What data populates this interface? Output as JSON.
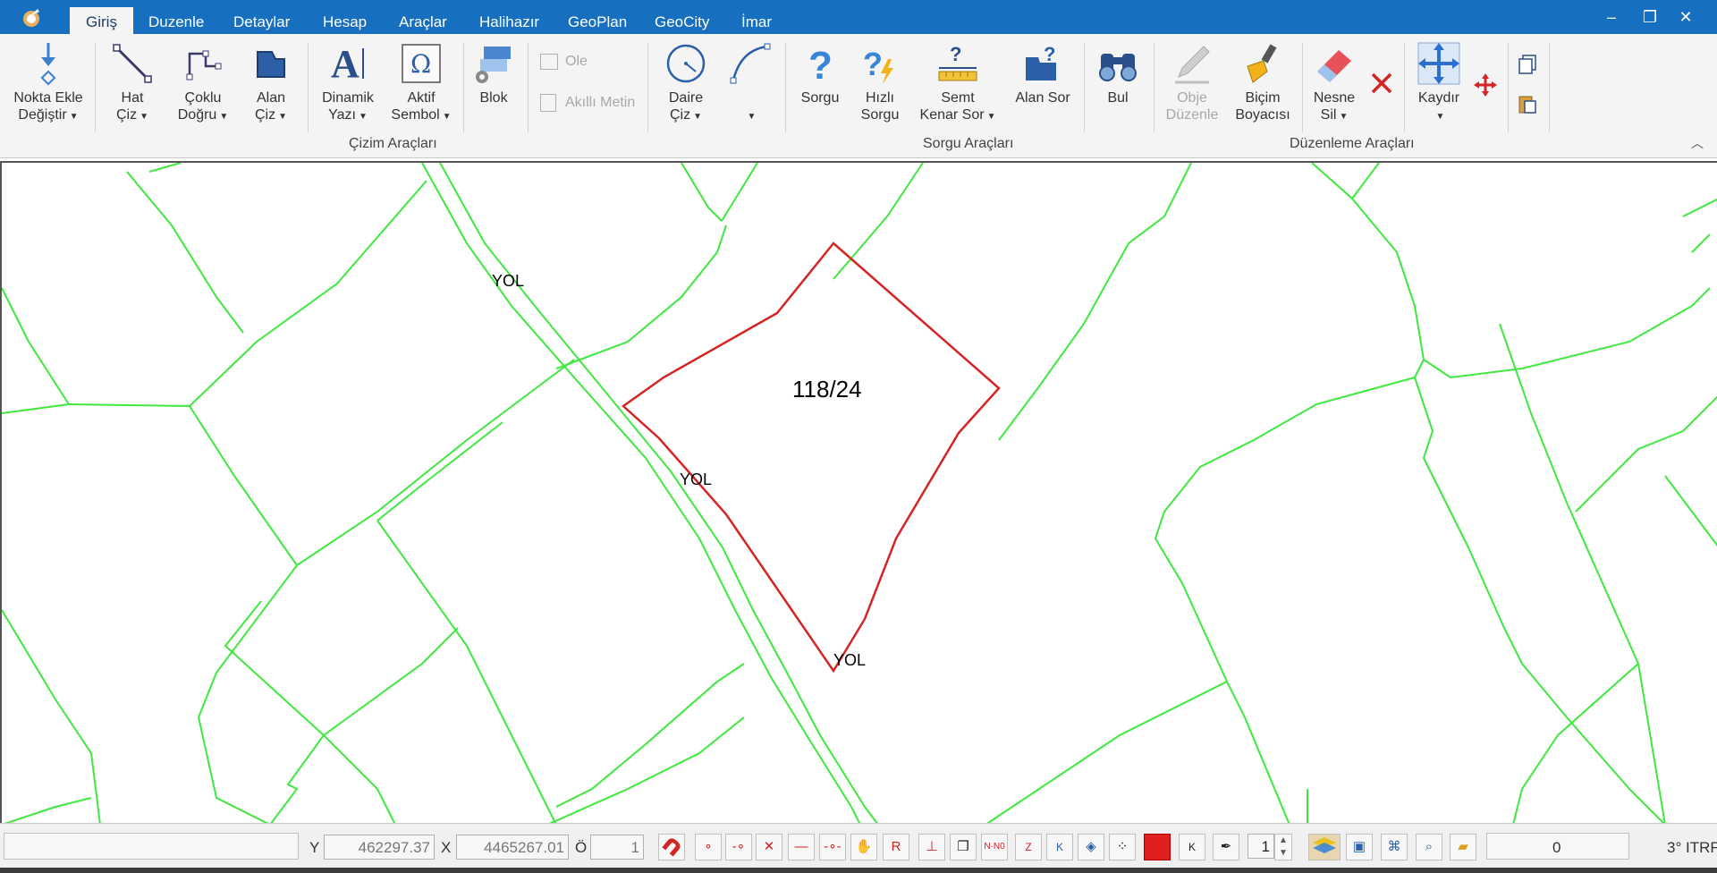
{
  "tabs": [
    {
      "label": "Giriş",
      "active": true
    },
    {
      "label": "Duzenle"
    },
    {
      "label": "Detaylar"
    },
    {
      "label": "Hesap"
    },
    {
      "label": "Araçlar"
    },
    {
      "label": "Halihazır"
    },
    {
      "label": "GeoPlan"
    },
    {
      "label": "GeoCity"
    },
    {
      "label": "İmar"
    }
  ],
  "window_controls": {
    "minimize": "–",
    "restore": "❐",
    "close": "✕"
  },
  "ribbon": {
    "buttons": {
      "nokta_ekle": {
        "l1": "Nokta Ekle",
        "l2": "Değiştir"
      },
      "hat_ciz": {
        "l1": "Hat",
        "l2": "Çiz"
      },
      "coklu_dogru": {
        "l1": "Çoklu",
        "l2": "Doğru"
      },
      "alan_ciz": {
        "l1": "Alan",
        "l2": "Çiz"
      },
      "dinamik_yazi": {
        "l1": "Dinamik",
        "l2": "Yazı"
      },
      "aktif_sembol": {
        "l1": "Aktif",
        "l2": "Sembol"
      },
      "blok": {
        "l1": "Blok"
      },
      "ole": {
        "l1": "Ole"
      },
      "akilli_metin": {
        "l1": "Akıllı Metin"
      },
      "daire_ciz": {
        "l1": "Daire",
        "l2": "Çiz"
      },
      "sorgu": {
        "l1": "Sorgu"
      },
      "hizli_sorgu": {
        "l1": "Hızlı",
        "l2": "Sorgu"
      },
      "semt_kenar": {
        "l1": "Semt",
        "l2": "Kenar Sor"
      },
      "alan_sor": {
        "l1": "Alan Sor"
      },
      "bul": {
        "l1": "Bul"
      },
      "obje_duzenle": {
        "l1": "Obje",
        "l2": "Düzenle"
      },
      "bicim_boyacisi": {
        "l1": "Biçim",
        "l2": "Boyacısı"
      },
      "nesne_sil": {
        "l1": "Nesne",
        "l2": "Sil"
      },
      "kaydir": {
        "l1": "Kaydır"
      }
    },
    "groups": {
      "cizim": "Çizim Araçları",
      "sorgu": "Sorgu Araçları",
      "duzenleme": "Düzenleme Araçları"
    }
  },
  "map": {
    "road_labels": [
      "YOL",
      "YOL",
      "YOL"
    ],
    "parcel_label": "118/24",
    "parcel_line_color": "#d42424",
    "boundary_color": "#3fe83f"
  },
  "statusbar": {
    "y_label": "Y",
    "y_value": "462297.37",
    "x_label": "X",
    "x_value": "4465267.01",
    "o_label": "Ö",
    "o_value": "1",
    "snap_r": "R",
    "layer_count": "1",
    "counter": "0",
    "crs": "3° ITRF"
  }
}
